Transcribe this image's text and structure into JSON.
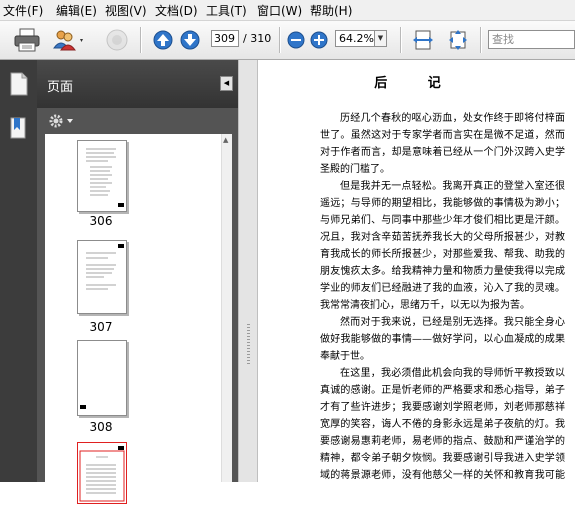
{
  "menu": [
    "文件(F)",
    "编辑(E)",
    "视图(V)",
    "文档(D)",
    "工具(T)",
    "窗口(W)",
    "帮助(H)"
  ],
  "toolbar": {
    "page_current": "309",
    "page_total": "/ 310",
    "zoom": "64.2%",
    "search_placeholder": "查找"
  },
  "sidebar": {
    "title": "页面",
    "thumbnails": [
      "306",
      "307",
      "308"
    ]
  },
  "document": {
    "title": "后  记",
    "paragraphs": [
      "历经几个春秋的呕心沥血，处女作终于即将付梓面世了。虽然这对于专家学者而言实在是微不足道，然而对于作者而言，却是意味着已经从一个门外汉跨入史学圣殿的门槛了。",
      "但是我并无一点轻松。我离开真正的登堂入室还很遥远；与导师的期望相比，我能够做的事情极为渺小；与师兄弟们、与同事中那些少年才俊们相比更是汗颜。况且，我对含辛茹苦抚养我长大的父母所报甚少，对教育我成长的师长所报甚少，对那些爱我、帮我、助我的朋友愧疚太多。给我精神力量和物质力量使我得以完成学业的师友们已经融进了我的血液，沁入了我的灵魂。我常常清夜扪心，思绪万千，以无以为报为苦。",
      "然而对于我来说，已经是别无选择。我只能全身心做好我能够做的事情——做好学问，以心血凝成的成果奉献于世。",
      "在这里，我必须借此机会向我的导师忻平教授致以真诚的感谢。正是忻老师的严格要求和悉心指导，弟子才有了些许进步；我要感谢刘学照老师，刘老师那慈祥宽厚的笑容，诲人不倦的身影永远是弟子夜航的灯。我要感谢易惠莉老师，易老师的指点、鼓励和严谨治学的精神，都令弟子朝夕恢悯。我要感谢引导我进入史学领域的蒋景源老师，没有他慈父一样的关怀和教育我可能就要永远徘徊于史学大门之外了。我要感谢费佩君老师、"
    ]
  }
}
